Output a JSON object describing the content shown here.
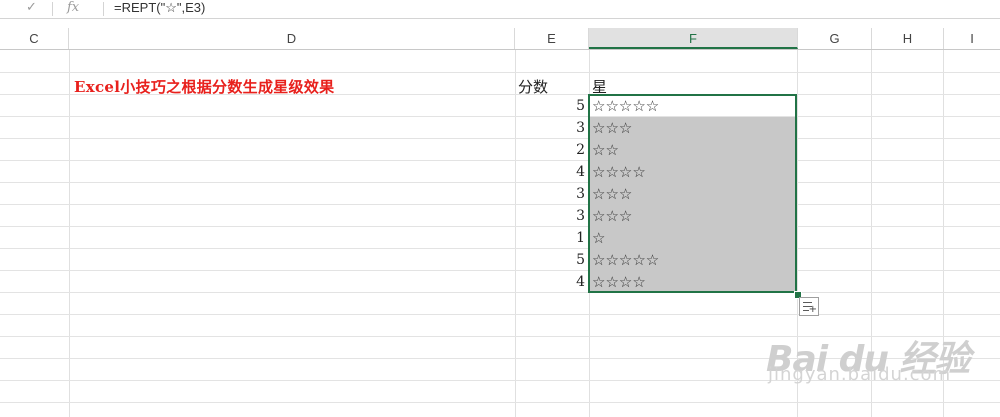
{
  "formula_bar": {
    "check_glyph": "✓",
    "fx_label": "fx",
    "formula": "=REPT(\"☆\",E3)"
  },
  "columns": [
    {
      "id": "C",
      "label": "C"
    },
    {
      "id": "D",
      "label": "D"
    },
    {
      "id": "E",
      "label": "E"
    },
    {
      "id": "F",
      "label": "F"
    },
    {
      "id": "G",
      "label": "G"
    },
    {
      "id": "H",
      "label": "H"
    },
    {
      "id": "I",
      "label": "I"
    }
  ],
  "selected_column": "F",
  "sheet": {
    "title": "Excel小技巧之根据分数生成星级效果",
    "score_header": "分数",
    "stars_header": "星",
    "rows": [
      {
        "score": "5",
        "stars": "☆☆☆☆☆"
      },
      {
        "score": "3",
        "stars": "☆☆☆"
      },
      {
        "score": "2",
        "stars": "☆☆"
      },
      {
        "score": "4",
        "stars": "☆☆☆☆"
      },
      {
        "score": "3",
        "stars": "☆☆☆"
      },
      {
        "score": "3",
        "stars": "☆☆☆"
      },
      {
        "score": "1",
        "stars": "☆"
      },
      {
        "score": "5",
        "stars": "☆☆☆☆☆"
      },
      {
        "score": "4",
        "stars": "☆☆☆☆"
      }
    ]
  },
  "watermark": {
    "main": "Bai du 经验",
    "sub": "jingyan.baidu.com"
  },
  "colors": {
    "title_red": "#e8201c",
    "selection_green": "#217346",
    "fill_gray": "#c8c8c8"
  },
  "icons": [
    "check-icon",
    "fx-icon",
    "quick-analysis-icon"
  ]
}
